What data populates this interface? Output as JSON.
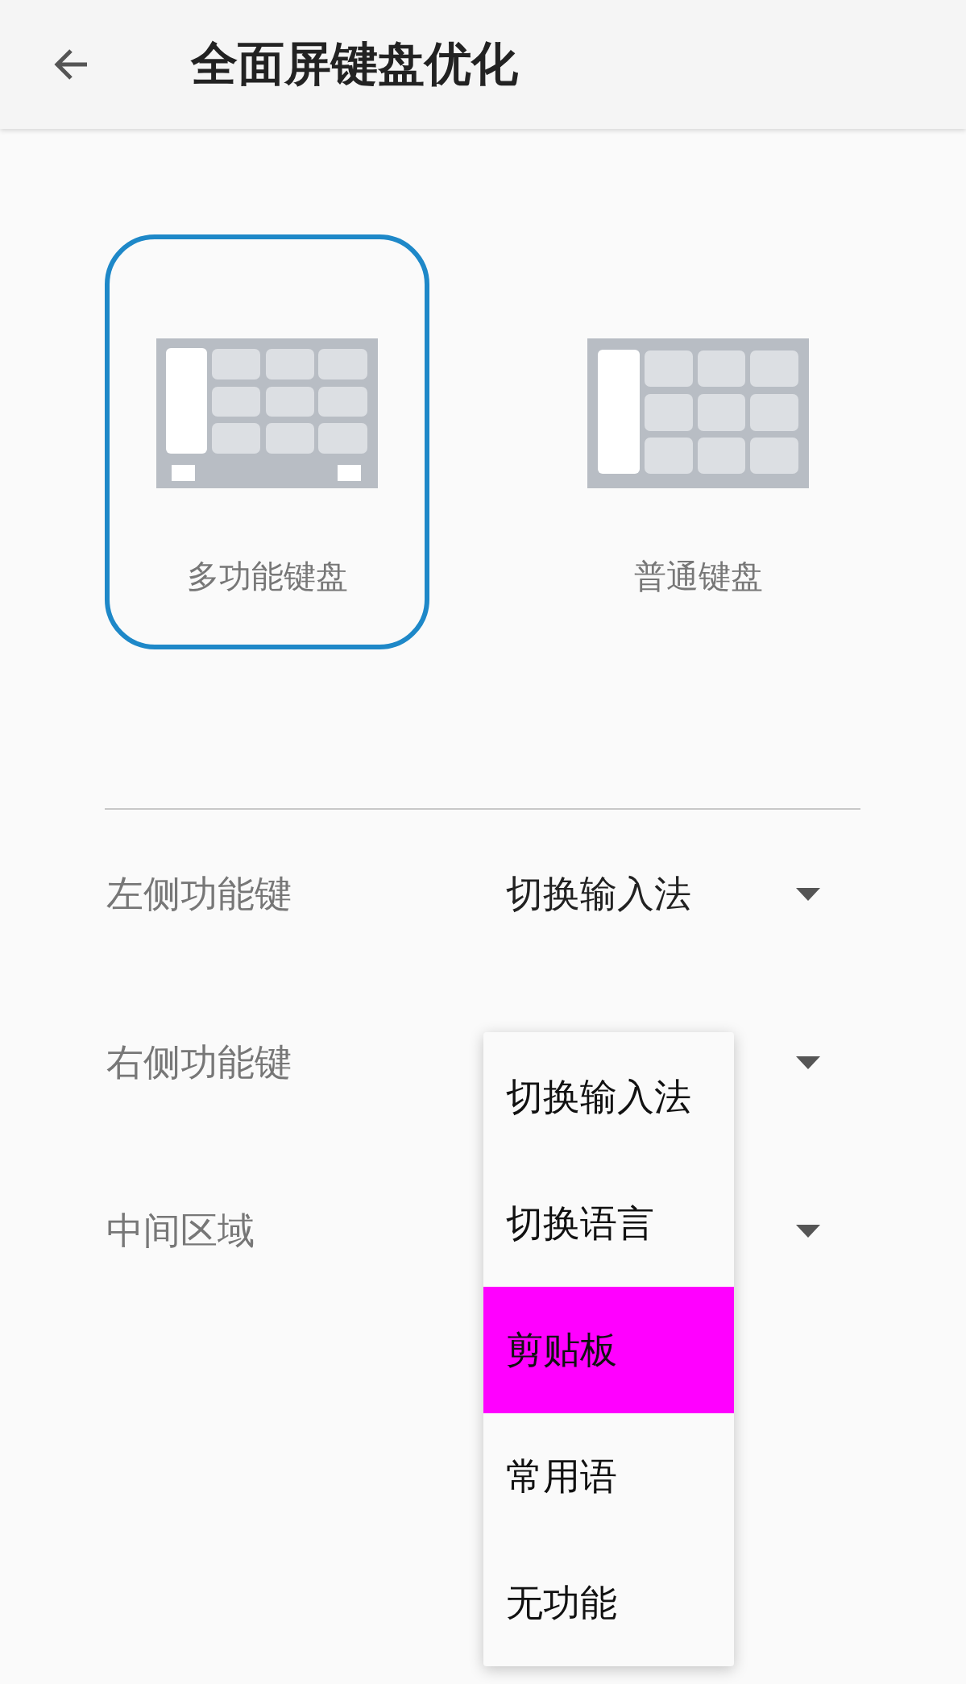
{
  "app_bar": {
    "title": "全面屏键盘优化"
  },
  "keyboard_options": [
    {
      "label": "多功能键盘",
      "kind": "multi",
      "selected": true
    },
    {
      "label": "普通键盘",
      "kind": "plain",
      "selected": false
    }
  ],
  "settings": [
    {
      "label": "左侧功能键",
      "value": "切换输入法"
    },
    {
      "label": "右侧功能键"
    },
    {
      "label": "中间区域"
    }
  ],
  "dropdown": {
    "items": [
      {
        "label": "切换输入法",
        "selected": false
      },
      {
        "label": "切换语言",
        "selected": false
      },
      {
        "label": "剪贴板",
        "selected": true
      },
      {
        "label": "常用语",
        "selected": false
      },
      {
        "label": "无功能",
        "selected": false
      }
    ]
  }
}
